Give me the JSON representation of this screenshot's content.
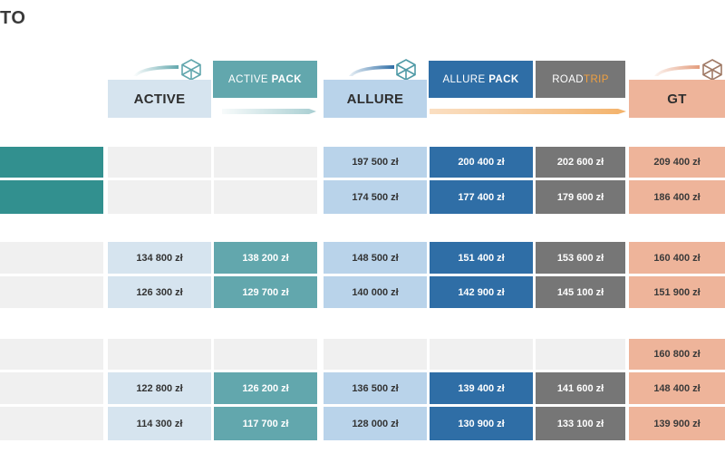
{
  "page": {
    "title": "TO"
  },
  "columns": [
    {
      "id": "active",
      "label": "ACTIVE"
    },
    {
      "id": "active_pack",
      "label_a": "ACTIVE ",
      "label_b": "PACK"
    },
    {
      "id": "allure",
      "label": "ALLURE"
    },
    {
      "id": "allure_pack",
      "label_a": "ALLURE ",
      "label_b": "PACK"
    },
    {
      "id": "roadtrip",
      "label_a": "ROAD",
      "label_b": "TRIP"
    },
    {
      "id": "gt",
      "label": "GT"
    }
  ],
  "rows": [
    {
      "active": "",
      "active_pack": "",
      "allure": "197 500 zł",
      "allure_pack": "200 400 zł",
      "roadtrip": "202 600 zł",
      "gt": "209 400 zł"
    },
    {
      "active": "",
      "active_pack": "",
      "allure": "174 500 zł",
      "allure_pack": "177 400 zł",
      "roadtrip": "179 600 zł",
      "gt": "186 400 zł"
    },
    {
      "active": "134 800 zł",
      "active_pack": "138 200 zł",
      "allure": "148 500 zł",
      "allure_pack": "151 400 zł",
      "roadtrip": "153 600 zł",
      "gt": "160 400 zł"
    },
    {
      "active": "126 300 zł",
      "active_pack": "129 700 zł",
      "allure": "140 000 zł",
      "allure_pack": "142 900 zł",
      "roadtrip": "145 100 zł",
      "gt": "151 900 zł"
    },
    {
      "active": "",
      "active_pack": "",
      "allure": "",
      "allure_pack": "",
      "roadtrip": "",
      "gt": "160 800 zł"
    },
    {
      "active": "122 800 zł",
      "active_pack": "126 200 zł",
      "allure": "136 500 zł",
      "allure_pack": "139 400 zł",
      "roadtrip": "141 600 zł",
      "gt": "148 400 zł"
    },
    {
      "active": "114 300 zł",
      "active_pack": "117 700 zł",
      "allure": "128 000 zł",
      "allure_pack": "130 900 zł",
      "roadtrip": "133 100 zł",
      "gt": "139 900 zł"
    }
  ],
  "colors": {
    "teal_row": "#32908f",
    "active": "#d6e4ef",
    "active_pack": "#62a7ad",
    "allure": "#b9d3ea",
    "allure_pack": "#2f6ea6",
    "roadtrip": "#767676",
    "roadtrip_accent": "#f0a040",
    "gt": "#eeb49a"
  },
  "icons": {
    "active": "cube-icon",
    "allure": "cube-icon",
    "gt": "cube-icon"
  }
}
